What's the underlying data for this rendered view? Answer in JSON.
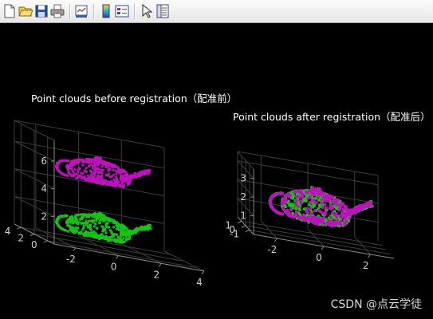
{
  "toolbar": {
    "buttons": [
      {
        "name": "new-figure-icon"
      },
      {
        "name": "open-file-icon"
      },
      {
        "name": "save-figure-icon"
      },
      {
        "name": "print-figure-icon"
      },
      {
        "name": "link-plot-icon"
      },
      {
        "name": "insert-colorbar-icon"
      },
      {
        "name": "insert-legend-icon"
      },
      {
        "name": "edit-plot-pointer-icon"
      },
      {
        "name": "open-property-inspector-icon"
      }
    ]
  },
  "colors": {
    "background": "#000000",
    "moving_cloud": "#c010c0",
    "fixed_cloud": "#14c414",
    "axis": "#8a8a8a",
    "grid": "#3c3c3c"
  },
  "chart_data": [
    {
      "type": "scatter",
      "title": "Point clouds before registration（配准前）",
      "xlim": [
        -3,
        4
      ],
      "ylim": [
        -1,
        5
      ],
      "zlim": [
        0,
        7.5
      ],
      "x_ticks": [
        "-2",
        "0",
        "2",
        "4"
      ],
      "y_ticks": [
        "0",
        "2",
        "4"
      ],
      "z_ticks": [
        "2",
        "4",
        "6"
      ],
      "series": [
        {
          "color": "#c010c0",
          "shape": "teapot",
          "center": [
            0,
            2,
            5.2
          ],
          "scale": 1.0
        },
        {
          "color": "#14c414",
          "shape": "teapot",
          "center": [
            0,
            2,
            1.2
          ],
          "scale": 1.0
        }
      ]
    },
    {
      "type": "scatter",
      "title": "Point clouds after registration（配准后）",
      "xlim": [
        -3,
        3
      ],
      "ylim": [
        -2,
        2
      ],
      "zlim": [
        0,
        3.5
      ],
      "x_ticks": [
        "-2",
        "0",
        "2"
      ],
      "y_ticks": [
        "-1",
        "0",
        "1"
      ],
      "z_ticks": [
        "1",
        "2",
        "3"
      ],
      "series": [
        {
          "color": "#14c414",
          "shape": "teapot",
          "center": [
            0,
            0,
            1.5
          ],
          "scale": 1.0
        },
        {
          "color": "#c010c0",
          "shape": "teapot",
          "center": [
            0,
            0,
            1.5
          ],
          "scale": 1.0
        }
      ]
    }
  ],
  "watermark": "CSDN @点云学徒"
}
